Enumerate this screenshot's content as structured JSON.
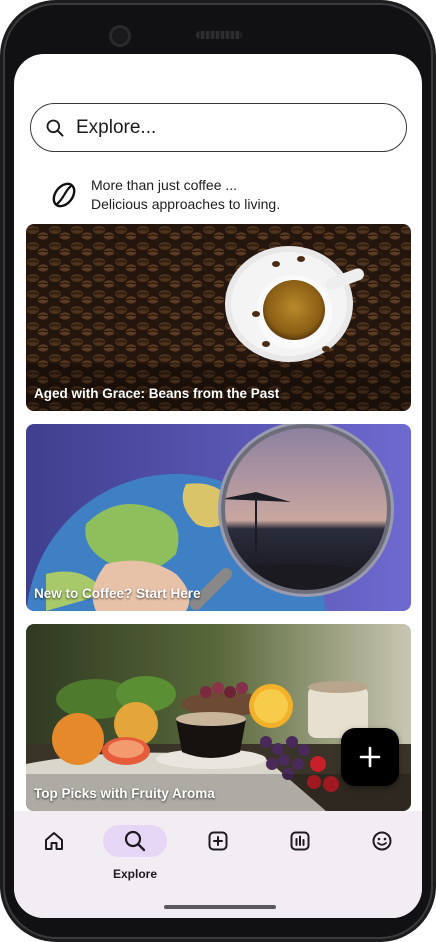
{
  "search": {
    "placeholder": "Explore..."
  },
  "tagline": {
    "line1": "More than just coffee ...",
    "line2": "Delicious approaches to living."
  },
  "cards": [
    {
      "title": "Aged with Grace: Beans from the Past",
      "image": "coffee-beans-espresso-cup"
    },
    {
      "title": "New to Coffee? Start Here",
      "image": "globe-magnifying-glass-beach"
    },
    {
      "title": "Top Picks with Fruity Aroma",
      "image": "fruits-and-coffee-cup"
    }
  ],
  "fab": {
    "icon": "plus-icon"
  },
  "nav": {
    "items": [
      {
        "icon": "home-icon",
        "label": ""
      },
      {
        "icon": "search-icon",
        "label": "Explore",
        "active": true
      },
      {
        "icon": "add-box-icon",
        "label": ""
      },
      {
        "icon": "bar-chart-icon",
        "label": ""
      },
      {
        "icon": "smiley-icon",
        "label": ""
      }
    ]
  },
  "colors": {
    "nav_background": "#f1edf3",
    "active_pill": "#e7d7f7",
    "fab": "#000000"
  }
}
